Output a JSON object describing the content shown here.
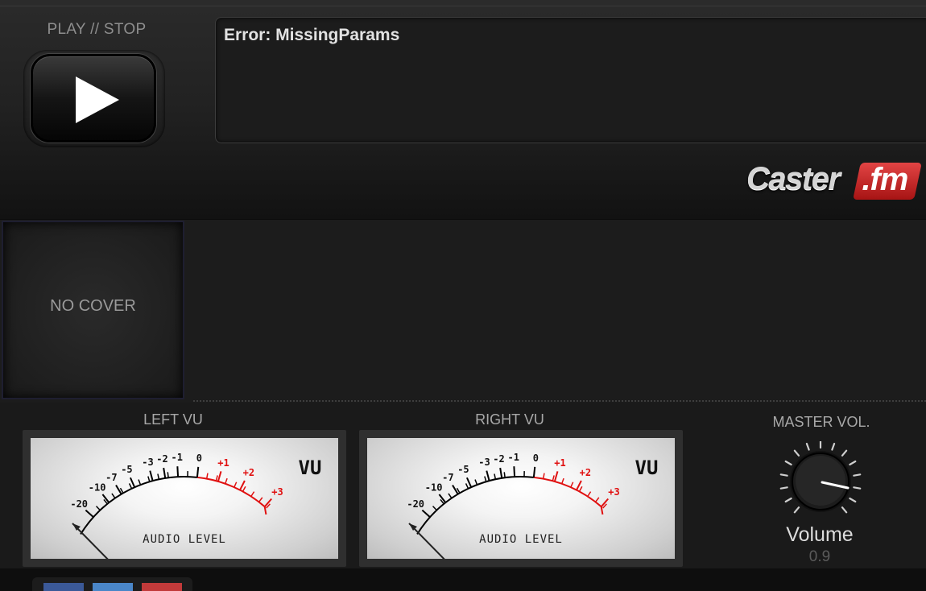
{
  "player": {
    "play_stop_label": "PLAY // STOP",
    "play_icon": "play-icon",
    "message": "Error: MissingParams",
    "logo": {
      "part1": "Caster",
      "part2": ".fm",
      "accent_color": "#c62828"
    }
  },
  "cover": {
    "text": "NO COVER"
  },
  "meters": {
    "left": {
      "label": "LEFT VU"
    },
    "right": {
      "label": "RIGHT VU"
    },
    "face_text": "AUDIO LEVEL",
    "unit": "VU",
    "scale": [
      "-20",
      "-10",
      "-7",
      "-5",
      "-3",
      "-2",
      "-1",
      "0",
      "+1",
      "+2",
      "+3"
    ]
  },
  "master": {
    "label": "MASTER VOL.",
    "volume_label": "Volume",
    "volume_value": "0.9"
  },
  "share": [
    {
      "name": "facebook",
      "color": "#3b5998"
    },
    {
      "name": "twitter",
      "color": "#4a86c8"
    },
    {
      "name": "google",
      "color": "#c23a3a"
    }
  ]
}
